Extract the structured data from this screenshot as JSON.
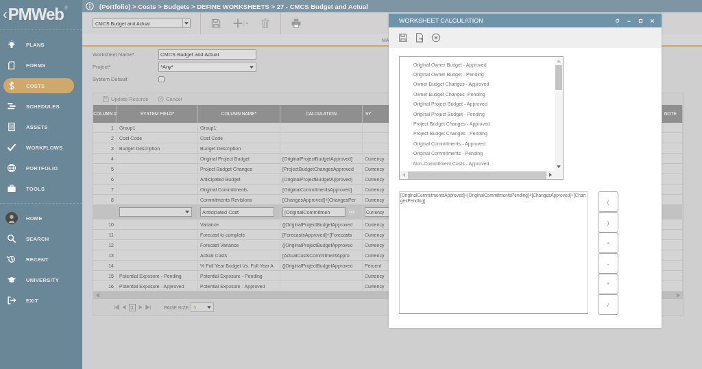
{
  "logo": {
    "back": "‹",
    "name": "PMWeb",
    "mark": "®"
  },
  "breadcrumb": "(Portfolio) > Costs > Budgets > DEFINE WORKSHEETS > 27 - CMCS Budget and Actual",
  "toolbar": {
    "worksheet_select": "CMCS Budget and Actual"
  },
  "tab_label": "MA",
  "sidebar": {
    "items": [
      {
        "label": "PLANS",
        "selected": false
      },
      {
        "label": "FORMS",
        "selected": false
      },
      {
        "label": "COSTS",
        "selected": true
      },
      {
        "label": "SCHEDULES",
        "selected": false
      },
      {
        "label": "ASSETS",
        "selected": false
      },
      {
        "label": "WORKFLOWS",
        "selected": false
      },
      {
        "label": "PORTFOLIO",
        "selected": false
      },
      {
        "label": "TOOLS",
        "selected": false
      }
    ],
    "bottom_items": [
      {
        "label": "HOME"
      },
      {
        "label": "SEARCH"
      },
      {
        "label": "RECENT"
      },
      {
        "label": "UNIVERSITY"
      },
      {
        "label": "EXIT"
      }
    ]
  },
  "form": {
    "worksheet_name_label": "Worksheet Name*",
    "worksheet_name": "CMCS Budget and Actual",
    "project_label": "Project*",
    "project": "*Any*",
    "system_default_label": "System Default",
    "system_default_checked": false
  },
  "grid": {
    "actions": [
      "Update Records",
      "Cancel"
    ],
    "columns": [
      "COLUMN #",
      "SYSTEM FIELD*",
      "COLUMN NAME*",
      "CALCULATION",
      "SY",
      "NOTE"
    ],
    "rows": [
      {
        "kind": "view",
        "number": "1",
        "system_field": "Group1",
        "column_name": "Group1"
      },
      {
        "kind": "view",
        "number": "2",
        "system_field": "Cost Code",
        "column_name": "Cost Code"
      },
      {
        "kind": "view",
        "number": "3",
        "system_field": "Budget Description",
        "column_name": "Budget Description"
      },
      {
        "kind": "view",
        "number": "4",
        "column_name": "Original Project Budget",
        "calculation": "[OriginalProjectBudgetApproved]",
        "column_5": "Currency"
      },
      {
        "kind": "view",
        "number": "5",
        "column_name": "Project Budget Changes",
        "calculation": "[ProjectBudgetChangesApproved",
        "column_5": "Currency"
      },
      {
        "kind": "view",
        "number": "6",
        "column_name": "Anticipated Budget",
        "calculation": "[OriginalProjectBudgetApproved]",
        "column_5": "Currency"
      },
      {
        "kind": "view",
        "number": "7",
        "column_name": "Original Commitments",
        "calculation": "[OriginalCommitmentsApproved]",
        "column_5": "Currency"
      },
      {
        "kind": "view",
        "number": "8",
        "column_name": "Commitments Revisions",
        "calculation": "[ChangesApproved]+[ChangesPer",
        "column_5": "Currency"
      },
      {
        "kind": "edit",
        "column_name": "Anticipated Cost",
        "calculation": "[OriginalCommitmen",
        "column_5": "Currency"
      },
      {
        "kind": "view",
        "number": "10",
        "column_name": "Variance",
        "calculation": "([OriginalProjectBudgetApproved",
        "column_5": "Currency"
      },
      {
        "kind": "view",
        "number": "11",
        "column_name": "Forecast to complete",
        "calculation": "[ForecastsApproved]+[Forecasts",
        "column_5": "Currency"
      },
      {
        "kind": "view",
        "number": "12",
        "column_name": "Forecast Variance",
        "calculation": "([OriginalProjectBudgetApproved",
        "column_5": "Currency"
      },
      {
        "kind": "view",
        "number": "13",
        "column_name": "Actual Costs",
        "calculation": "[ActualCostsCommitmentAppro",
        "column_5": "Currency"
      },
      {
        "kind": "view",
        "number": "14",
        "column_name": "% Full Year Budget Vs. Full Year A",
        "calculation": "([OriginalProjectBudgetApproved",
        "column_5": "Percent"
      },
      {
        "kind": "view",
        "number": "15",
        "system_field": "Potential Exposure - Pending",
        "column_name": "Potential Exposure - Pending",
        "column_5": "Currency"
      },
      {
        "kind": "view",
        "number": "16",
        "system_field": "Potential Exposure - Approved",
        "column_name": "Potential Exposure - Approved",
        "column_5": "Currency"
      }
    ],
    "pager": {
      "page": "1",
      "page_size_label": "PAGE SIZE",
      "page_size": "5"
    }
  },
  "dialog": {
    "title": "WORKSHEET CALCULATION",
    "fields": [
      "Original Owner Budget - Approved",
      "Original Owner Budget - Pending",
      "Owner Budget Changes - Approved",
      "Owner Budget Changes -Pending",
      "Original Project Budget - Approved",
      "Original Project Budget - Pending",
      "Project Budget Changes - Approved",
      "Project Budget Changes - Pending",
      "Original Commitments - Approved",
      "Original Commitments - Pending",
      "Non-Commitment Costs - Approved"
    ],
    "formula": "[OriginalCommitmentsApproved]+[OriginalCommitmentsPending]+[ChangesApproved]+[ChangesPending]",
    "operators": [
      "(",
      ")",
      "+",
      "-",
      "*",
      "/"
    ]
  }
}
